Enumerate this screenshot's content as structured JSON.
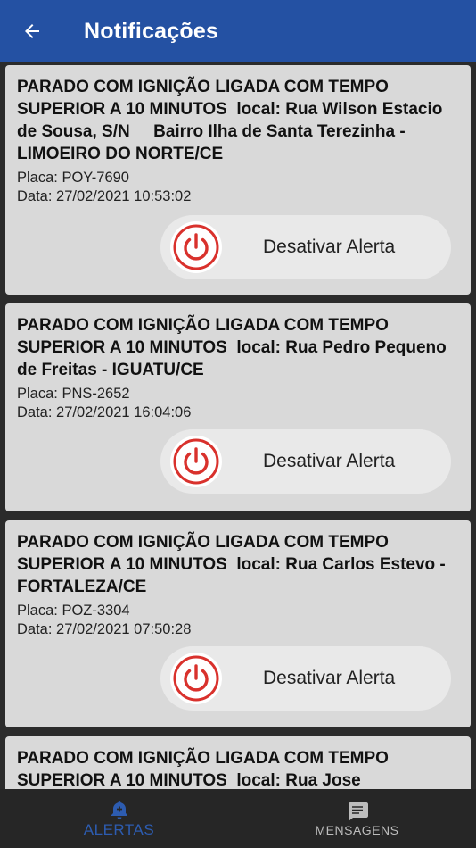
{
  "header": {
    "title": "Notificações",
    "back_icon": "arrow-left-icon"
  },
  "notifications": [
    {
      "title": "PARADO COM IGNIÇÃO LIGADA COM TEMPO SUPERIOR A 10 MINUTOS  local: Rua Wilson Estacio de Sousa, S/N     Bairro Ilha de Santa Terezinha - LIMOEIRO DO NORTE/CE",
      "placa": "Placa: POY-7690",
      "data": "Data: 27/02/2021 10:53:02",
      "button_label": "Desativar Alerta"
    },
    {
      "title": "PARADO COM IGNIÇÃO LIGADA COM TEMPO SUPERIOR A 10 MINUTOS  local: Rua Pedro Pequeno de Freitas - IGUATU/CE",
      "placa": "Placa: PNS-2652",
      "data": "Data: 27/02/2021 16:04:06",
      "button_label": "Desativar Alerta"
    },
    {
      "title": "PARADO COM IGNIÇÃO LIGADA COM TEMPO SUPERIOR A 10 MINUTOS  local: Rua Carlos Estevo - FORTALEZA/CE",
      "placa": "Placa: POZ-3304",
      "data": "Data: 27/02/2021 07:50:28",
      "button_label": "Desativar Alerta"
    },
    {
      "title": "PARADO COM IGNIÇÃO LIGADA COM TEMPO SUPERIOR A 10 MINUTOS  local: Rua Jose"
    }
  ],
  "bottom_nav": {
    "alertas": {
      "label": "ALERTAS",
      "icon": "bell-plus-icon",
      "active": true
    },
    "mensagens": {
      "label": "MENSAGENS",
      "icon": "message-icon",
      "active": false
    }
  },
  "colors": {
    "header": "#2451a3",
    "card": "#d9d9d9",
    "power": "#d9312c",
    "nav_active": "#2d5cb0"
  }
}
